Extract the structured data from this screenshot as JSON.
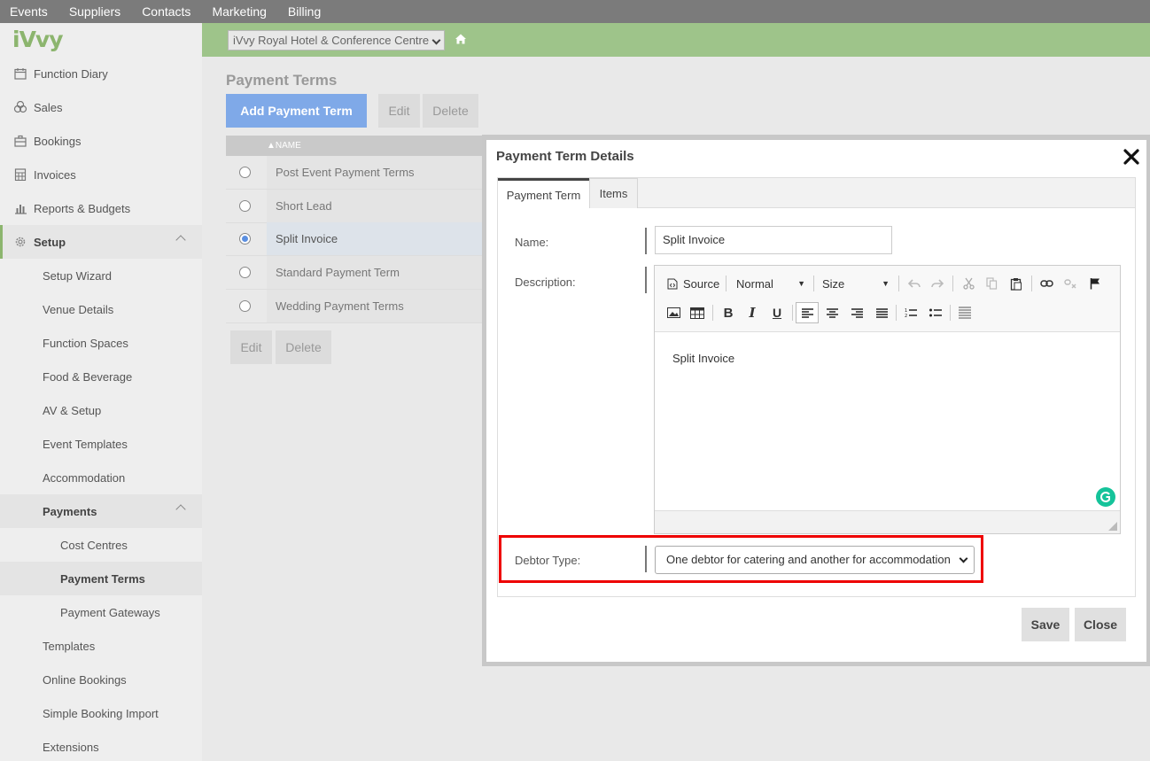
{
  "topnav": [
    "Events",
    "Suppliers",
    "Contacts",
    "Marketing",
    "Billing"
  ],
  "brand": "iVvy",
  "sidebar": {
    "main": [
      {
        "label": "Function Diary",
        "icon": "calendar-icon"
      },
      {
        "label": "Sales",
        "icon": "sales-icon"
      },
      {
        "label": "Bookings",
        "icon": "briefcase-icon"
      },
      {
        "label": "Invoices",
        "icon": "calculator-icon"
      },
      {
        "label": "Reports & Budgets",
        "icon": "bar-chart-icon"
      },
      {
        "label": "Setup",
        "icon": "gear-icon"
      }
    ],
    "setup_items": [
      "Setup Wizard",
      "Venue Details",
      "Function Spaces",
      "Food & Beverage",
      "AV & Setup",
      "Event Templates",
      "Accommodation",
      "Payments"
    ],
    "payments_items": [
      "Cost Centres",
      "Payment Terms",
      "Payment Gateways"
    ],
    "after_items": [
      "Templates",
      "Online Bookings",
      "Simple Booking Import",
      "Extensions"
    ]
  },
  "venue": "iVvy Royal Hotel & Conference Centre",
  "page": {
    "title": "Payment Terms",
    "add_button": "Add Payment Term",
    "edit_button": "Edit",
    "delete_button": "Delete",
    "column_header": "NAME",
    "rows": [
      "Post Event Payment Terms",
      "Short Lead",
      "Split Invoice",
      "Standard Payment Term",
      "Wedding Payment Terms"
    ],
    "selected_index": 2
  },
  "modal": {
    "title": "Payment Term Details",
    "tabs": [
      "Payment Term",
      "Items"
    ],
    "name_label": "Name:",
    "name_value": "Split Invoice",
    "description_label": "Description:",
    "toolbar": {
      "source": "Source",
      "format": "Normal",
      "size": "Size"
    },
    "description_value": "Split Invoice",
    "debtor_label": "Debtor Type:",
    "debtor_value": "One debtor for catering and another for accommodation",
    "save": "Save",
    "close": "Close"
  },
  "colors": {
    "accent_green": "#9ec48a",
    "primary_blue": "#7fa9e8",
    "highlight_red": "#e00000"
  }
}
